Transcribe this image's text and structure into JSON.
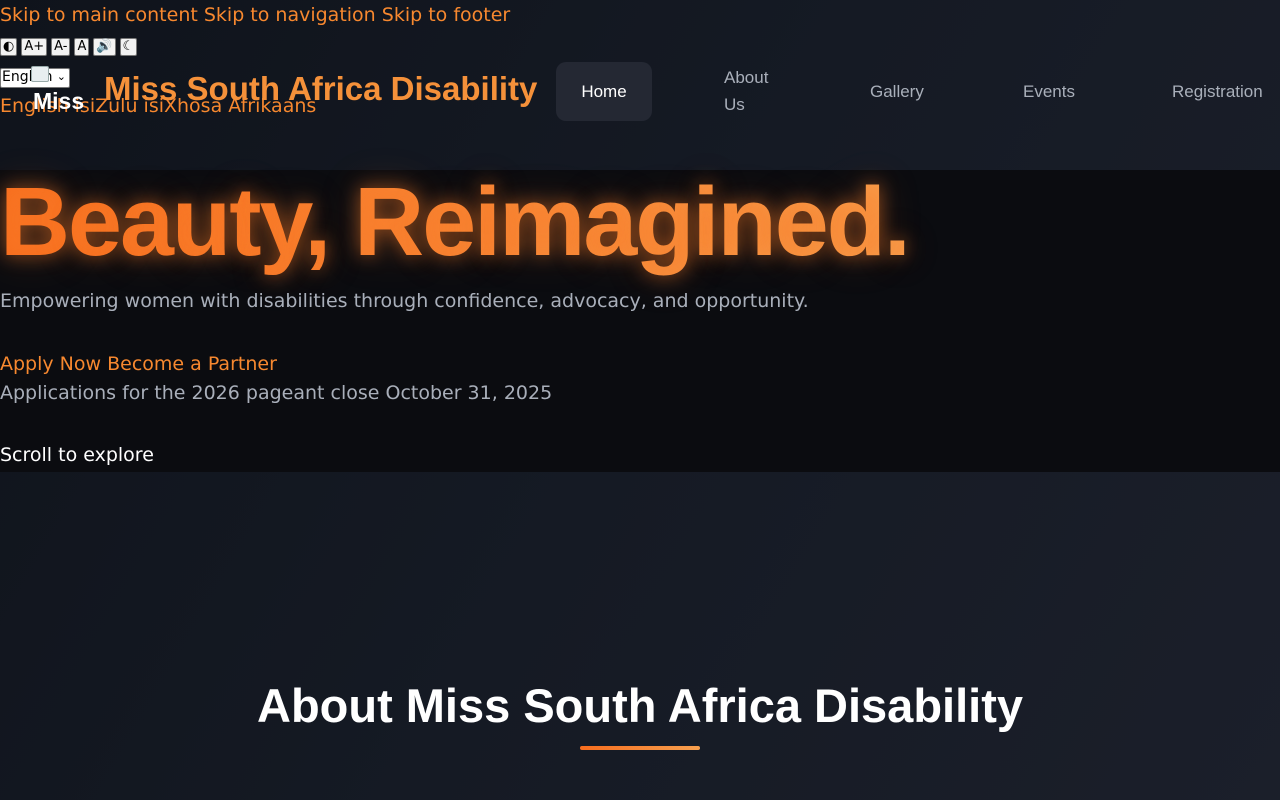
{
  "skip_links": [
    "Skip to main content",
    "Skip to navigation",
    "Skip to footer"
  ],
  "accessibility": {
    "contrast": "◐",
    "increase": "A+",
    "decrease": "A-",
    "reset": "A",
    "speak": "🔊",
    "dark": "☾"
  },
  "language_select": {
    "value": "English"
  },
  "brand": {
    "short": "Miss",
    "title": "Miss South Africa Disability"
  },
  "language_links": [
    "English",
    "isiZulu",
    "isiXhosa",
    "Afrikaans"
  ],
  "nav": {
    "items": [
      "Home",
      "About Us",
      "Gallery",
      "Events",
      "Registration"
    ],
    "active": "Home"
  },
  "hero": {
    "title": "Beauty, Reimagined.",
    "subtitle": "Empowering women with disabilities through confidence, advocacy, and opportunity.",
    "cta_apply": "Apply Now",
    "cta_partner": "Become a Partner",
    "deadline": "Applications for the 2026 pageant close October 31, 2025",
    "scroll": "Scroll to explore"
  },
  "about": {
    "title": "About Miss South Africa Disability"
  },
  "colors": {
    "accent": "#f7882f",
    "background": "#141821",
    "hero_bg": "#0b0c10"
  }
}
